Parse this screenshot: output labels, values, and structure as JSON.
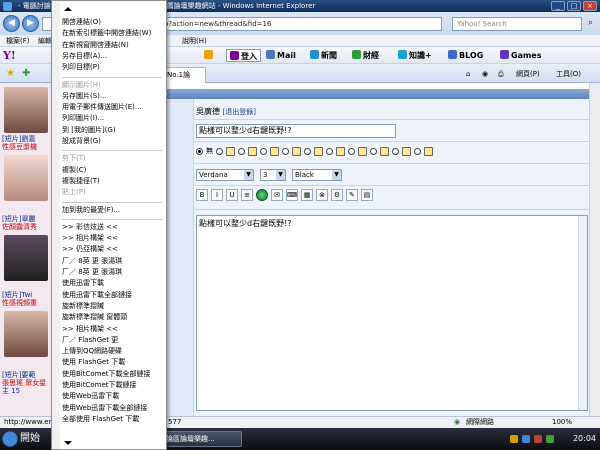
{
  "window": {
    "title": "- 電腦討論區論壇樂趣網 - ...bbs  ......問題 ... 推薦論壇樂趣網站 - Windows Internet Explorer",
    "min": "_",
    "max": "□",
    "close": "×"
  },
  "address": {
    "url": "php?action=new&thread&fid=16",
    "search_placeholder": "Yahoo! Search",
    "search_go": "⌕"
  },
  "menubar": {
    "items": [
      "檔案(F)",
      "編輯",
      "說明(H)"
    ]
  },
  "yahoo_toolbar": {
    "logo": "Y!",
    "login": "登入",
    "mail": "Mail",
    "news": "新聞",
    "finance": "財經",
    "knowledge": "知識+",
    "blog": "BLOG",
    "games": "Games"
  },
  "tabbar": {
    "tab_label": "香港No.1論",
    "page": "網頁(P)",
    "tools": "工具(O)"
  },
  "left_panel": {
    "captions": [
      "[短片]劉嘉",
      "性感豆漿機",
      "[短片]翠麗",
      "佐顏露清秀",
      "[短片]Twi",
      "性感視頻重",
      "[短片]要範",
      "張思瑤 眾女星",
      "主 15"
    ]
  },
  "forum": {
    "username": "吳廣德",
    "logout": "[退出登錄]",
    "subject": "點樣可以整少d右鍵既野!?",
    "radio_none_label": "無",
    "font": "Verdana",
    "size": "3",
    "color": "Black",
    "message": "點樣可以整少d右鍵既野!?",
    "format_buttons": [
      "B",
      "I",
      "U",
      "≡",
      "",
      "✉",
      "⌨",
      "▦",
      "⊗",
      "⚙",
      "✎",
      "▤"
    ]
  },
  "context_menu": {
    "items": [
      {
        "label": "開啓連結(O)",
        "disabled": false
      },
      {
        "label": "在新索引標籤中開啓連結(W)",
        "disabled": false
      },
      {
        "label": "在新視窗開啓連結(N)",
        "disabled": false
      },
      {
        "label": "另存目標(A)...",
        "disabled": false
      },
      {
        "label": "列印目標(P)",
        "disabled": false
      },
      {
        "label": "顯示圖片(H)",
        "disabled": true
      },
      {
        "label": "另存圖片(S)...",
        "disabled": false
      },
      {
        "label": "用電子郵件傳送圖片(E)...",
        "disabled": false
      },
      {
        "label": "列印圖片(I)...",
        "disabled": false
      },
      {
        "label": "到 [我的圖片](G)",
        "disabled": false
      },
      {
        "label": "設成背景(G)",
        "disabled": false
      },
      {
        "label": "剪下(T)",
        "disabled": true
      },
      {
        "label": "複製(C)",
        "disabled": false
      },
      {
        "label": "複製捷徑(T)",
        "disabled": false
      },
      {
        "label": "貼上(P)",
        "disabled": true
      },
      {
        "label": "加到我的最愛(F)...",
        "disabled": false
      },
      {
        "label": ">> 彩信炫送 <<",
        "disabled": false
      },
      {
        "label": ">> 相片構架 <<",
        "disabled": false
      },
      {
        "label": ">> 仍亞構架 <<",
        "disabled": false
      },
      {
        "label": "厂／ 8英    更    張湯琪",
        "disabled": false
      },
      {
        "label": "厂／ 8英    更    張湯琪",
        "disabled": false
      },
      {
        "label": "使用迅雷下載",
        "disabled": false
      },
      {
        "label": "使用迅雷下載全部鏈接",
        "disabled": false
      },
      {
        "label": "旋新標準摺贓",
        "disabled": false
      },
      {
        "label": "旋新標準摺贓    窗體頭",
        "disabled": false
      },
      {
        "label": ">> 相片構架 <<",
        "disabled": false
      },
      {
        "label": "厂／ FlashGet    更",
        "disabled": false
      },
      {
        "label": "上傳到QQ網路硬碟",
        "disabled": false
      },
      {
        "label": "使用 FlashGet 下載",
        "disabled": false
      },
      {
        "label": "使用BitComet下載全部鏈接",
        "disabled": false
      },
      {
        "label": "使用BitComet下載鏈接",
        "disabled": false
      },
      {
        "label": "使用Web迅雷下載",
        "disabled": false
      },
      {
        "label": "使用Web迅雷下載全部鏈接",
        "disabled": false
      },
      {
        "label": "全部使用 FlashGet 下載",
        "disabled": false
      }
    ]
  },
  "statusbar": {
    "url": "http://www.ent",
    "number": "577",
    "zone": "網際網路",
    "zoom": "100%"
  },
  "taskbar": {
    "start": "開始",
    "task": "電腦討論區論壇樂趣...",
    "clock": "20:04"
  }
}
